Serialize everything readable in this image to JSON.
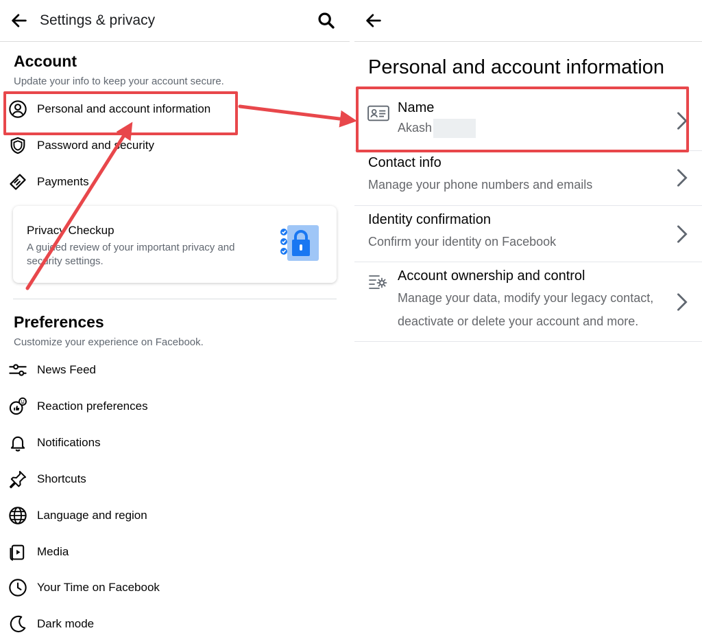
{
  "left_panel": {
    "header": {
      "title": "Settings & privacy"
    },
    "account": {
      "title": "Account",
      "subtitle": "Update your info to keep your account secure.",
      "items": [
        {
          "label": "Personal and account information",
          "icon": "user-circle-icon"
        },
        {
          "label": "Password and security",
          "icon": "shield-icon"
        },
        {
          "label": "Payments",
          "icon": "tag-icon"
        }
      ]
    },
    "privacy_checkup": {
      "title": "Privacy Checkup",
      "description": "A guided review of your important privacy and security settings.",
      "icon": "privacy-lock-illustration-icon"
    },
    "preferences": {
      "title": "Preferences",
      "subtitle": "Customize your experience on Facebook.",
      "items": [
        {
          "label": "News Feed",
          "icon": "sliders-icon"
        },
        {
          "label": "Reaction preferences",
          "icon": "reaction-icon"
        },
        {
          "label": "Notifications",
          "icon": "bell-icon"
        },
        {
          "label": "Shortcuts",
          "icon": "pin-icon"
        },
        {
          "label": "Language and region",
          "icon": "globe-icon"
        },
        {
          "label": "Media",
          "icon": "media-icon"
        },
        {
          "label": "Your Time on Facebook",
          "icon": "clock-icon"
        },
        {
          "label": "Dark mode",
          "icon": "moon-icon"
        }
      ]
    }
  },
  "right_panel": {
    "title": "Personal and account information",
    "rows": [
      {
        "title": "Name",
        "subtitle": "Akash",
        "icon": "id-card-icon"
      },
      {
        "title": "Contact info",
        "subtitle": "Manage your phone numbers and emails"
      },
      {
        "title": "Identity confirmation",
        "subtitle": "Confirm your identity on Facebook"
      },
      {
        "title": "Account ownership and control",
        "subtitle": "Manage your data, modify your legacy contact, deactivate or delete your account and more.",
        "icon": "settings-list-icon"
      }
    ]
  },
  "colors": {
    "annotation_red": "#e8474b",
    "text_primary": "#050505",
    "text_secondary": "#65676b",
    "illustration_blue": "#1877f2"
  }
}
